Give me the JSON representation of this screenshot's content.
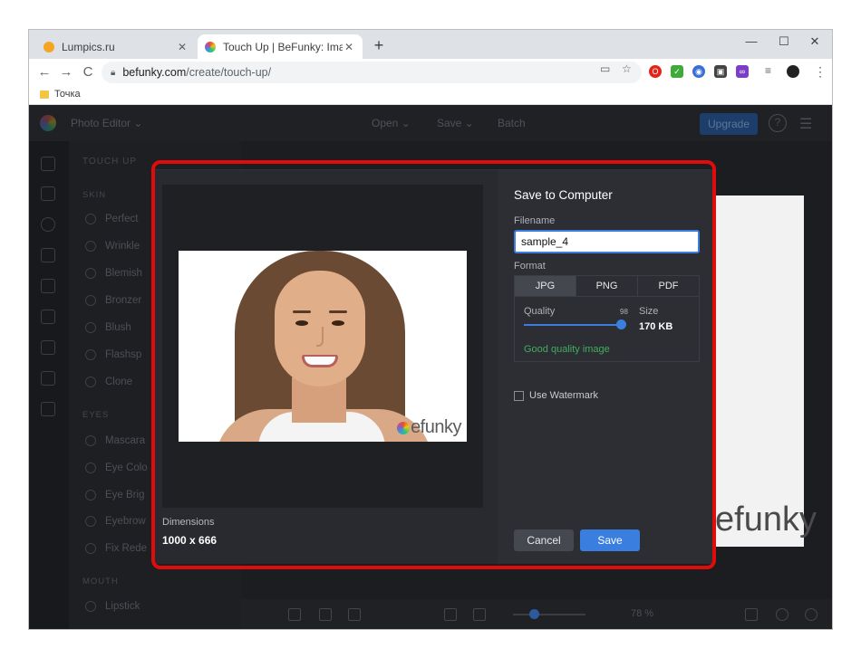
{
  "browser": {
    "tabs": [
      {
        "title": "Lumpics.ru",
        "active": false,
        "favicon_color": "#f4a623"
      },
      {
        "title": "Touch Up | BeFunky: Image Retouc",
        "active": true,
        "favicon_color": "#4c8bf5"
      }
    ],
    "new_tab": "+",
    "window_controls": {
      "minimize": "—",
      "maximize": "☐",
      "close": "✕"
    },
    "nav": {
      "back": "←",
      "forward": "→",
      "reload": "C"
    },
    "url_host": "befunky.com",
    "url_path": "/create/touch-up/",
    "bookmark": "Точка"
  },
  "app": {
    "header": {
      "photo_editor": "Photo Editor ⌄",
      "open": "Open ⌄",
      "save": "Save ⌄",
      "batch": "Batch",
      "upgrade": "Upgrade",
      "help": "?"
    },
    "sidebar": {
      "title": "TOUCH UP",
      "skin_label": "SKIN",
      "skin_items": [
        "Perfect",
        "Wrinkle",
        "Blemish",
        "Bronzer",
        "Blush",
        "Flashsp",
        "Clone"
      ],
      "eyes_label": "EYES",
      "eyes_items": [
        "Mascara",
        "Eye Colo",
        "Eye Brig",
        "Eyebrow",
        "Fix Rede"
      ],
      "mouth_label": "MOUTH",
      "mouth_items": [
        "Lipstick"
      ]
    },
    "zoom": "78 %",
    "background_watermark": "efunky"
  },
  "dialog": {
    "title": "Save to Computer",
    "filename_label": "Filename",
    "filename_value": "sample_4",
    "format_label": "Format",
    "formats": [
      "JPG",
      "PNG",
      "PDF"
    ],
    "selected_format": "JPG",
    "quality_label": "Quality",
    "quality_value": "98",
    "size_label": "Size",
    "size_value": "170 KB",
    "quality_message": "Good quality image",
    "watermark_label": "Use Watermark",
    "watermark_checked": false,
    "dimensions_label": "Dimensions",
    "dimensions_value": "1000 x 666",
    "preview_watermark": "efunky",
    "cancel": "Cancel",
    "save": "Save"
  },
  "colors": {
    "accent": "#3a7ee0",
    "highlight": "#e00c0c",
    "good": "#3fae5d"
  }
}
